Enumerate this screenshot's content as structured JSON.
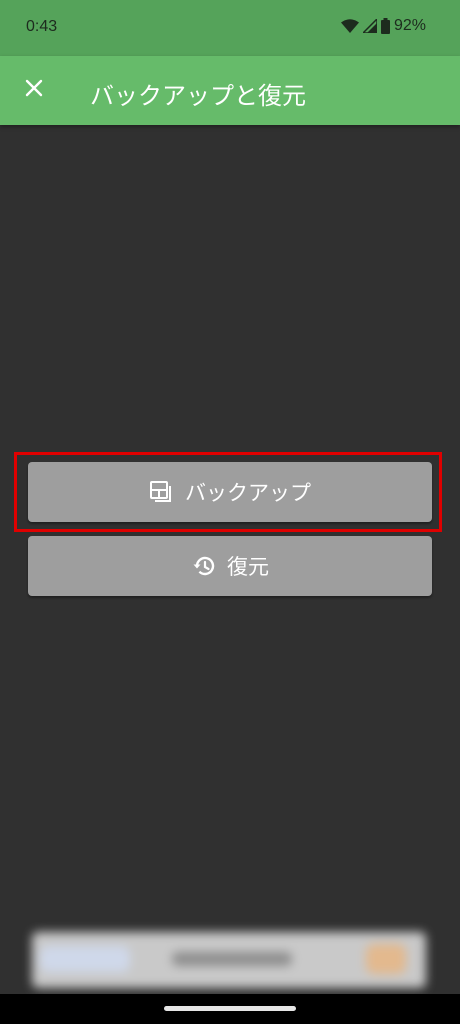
{
  "status_bar": {
    "time": "0:43",
    "battery": "92%",
    "icons": [
      "wifi-icon",
      "signal-icon",
      "battery-icon"
    ]
  },
  "app_bar": {
    "close_icon": "close-icon",
    "title": "バックアップと復元"
  },
  "actions": {
    "backup": {
      "label": "バックアップ",
      "icon": "backup-icon"
    },
    "restore": {
      "label": "復元",
      "icon": "history-icon"
    }
  },
  "colors": {
    "status_bar": "#55a35a",
    "app_bar": "#66bb6a",
    "background": "#303030",
    "button": "#9e9e9e",
    "highlight": "#e00000"
  }
}
